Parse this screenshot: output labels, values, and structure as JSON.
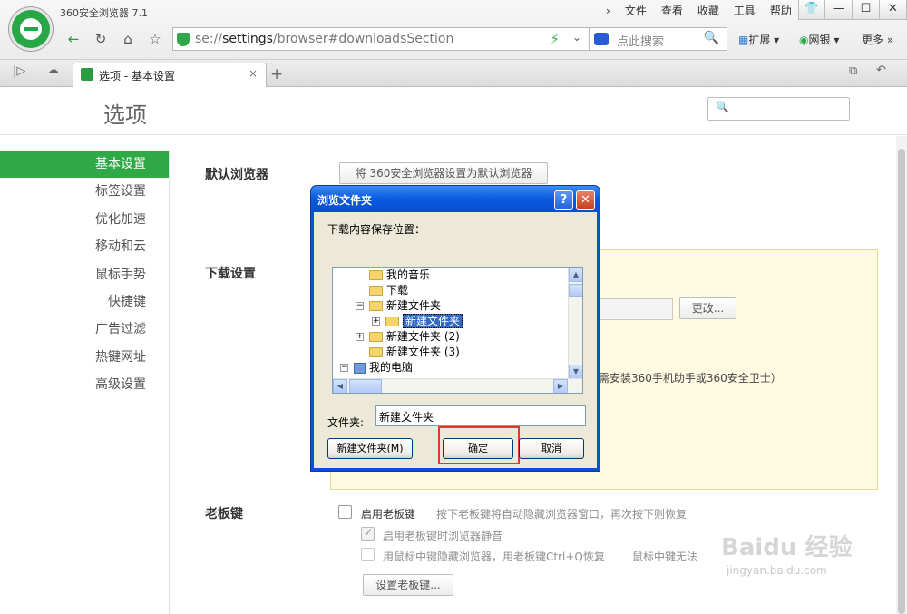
{
  "browser": {
    "app_title": "360安全浏览器 7.1",
    "menu": [
      "文件",
      "查看",
      "收藏",
      "工具",
      "帮助"
    ],
    "window_buttons": [
      "👕",
      "—",
      "☐",
      "✕"
    ],
    "url_prefix": "se://",
    "url_host": "settings",
    "url_path": "/browser#downloadsSection",
    "search_placeholder": "点此搜索",
    "extensions_label": "扩展",
    "bank_label": "网银",
    "more_label": "更多",
    "more_arrow": "»",
    "tab_title": "选项 - 基本设置",
    "tab_close": "×",
    "new_tab": "+",
    "nav_icons": {
      "back": "←",
      "refresh": "↻",
      "home": "⌂",
      "favorite": "☆",
      "sidebar": "|▷",
      "cloud": "☁",
      "bolt": "⚡",
      "dropdown": "⌄",
      "search": "🔍",
      "restore": "⧉",
      "undo": "↶"
    }
  },
  "settings": {
    "page_title": "选项",
    "search_icon_glyph": "🔍",
    "sidebar": [
      {
        "label": "基本设置",
        "active": true
      },
      {
        "label": "标签设置"
      },
      {
        "label": "优化加速"
      },
      {
        "label": "移动和云"
      },
      {
        "label": "鼠标手势"
      },
      {
        "label": "快捷键"
      },
      {
        "label": "广告过滤"
      },
      {
        "label": "热键网址"
      },
      {
        "label": "高级设置"
      }
    ],
    "default_browser": {
      "label": "默认浏览器",
      "button": "将 360安全浏览器设置为默认浏览器"
    },
    "download": {
      "label": "下载设置",
      "change_button": "更改...",
      "note": "需安装360手机助手或360安全卫士）"
    },
    "boss_key": {
      "label": "老板键",
      "enable": {
        "label": "启用老板键",
        "checked": false
      },
      "enable_hint": "按下老板键将自动隐藏浏览器窗口，再次按下则恢复",
      "mute": {
        "label": "启用老板键时浏览器静音",
        "checked": true
      },
      "middle_click": {
        "label": "用鼠标中键隐藏浏览器，用老板键Ctrl+Q恢复",
        "checked": false
      },
      "middle_click_hint": "鼠标中键无法",
      "set_button": "设置老板键..."
    }
  },
  "dialog": {
    "title": "浏览文件夹",
    "help": "?",
    "close": "✕",
    "prompt": "下载内容保存位置：",
    "tree": [
      {
        "label": "我的音乐",
        "expander": ""
      },
      {
        "label": "下载",
        "expander": ""
      },
      {
        "label": "新建文件夹",
        "expander": "−"
      },
      {
        "label": "新建文件夹",
        "expander": "+",
        "selected": true
      },
      {
        "label": "新建文件夹 (2)",
        "expander": "+"
      },
      {
        "label": "新建文件夹 (3)",
        "expander": ""
      },
      {
        "label": "我的电脑",
        "expander": "−",
        "icon": "computer"
      }
    ],
    "folder_label": "文件夹:",
    "folder_value": "新建文件夹",
    "new_folder_button": "新建文件夹(M)",
    "ok_button": "确定",
    "cancel_button": "取消"
  },
  "watermark": {
    "brand": "Baidu 经验",
    "url": "jingyan.baidu.com"
  },
  "colors": {
    "accent": "#2ea946",
    "dialog_blue": "#0a51d8",
    "highlight": "#e03a2e"
  }
}
